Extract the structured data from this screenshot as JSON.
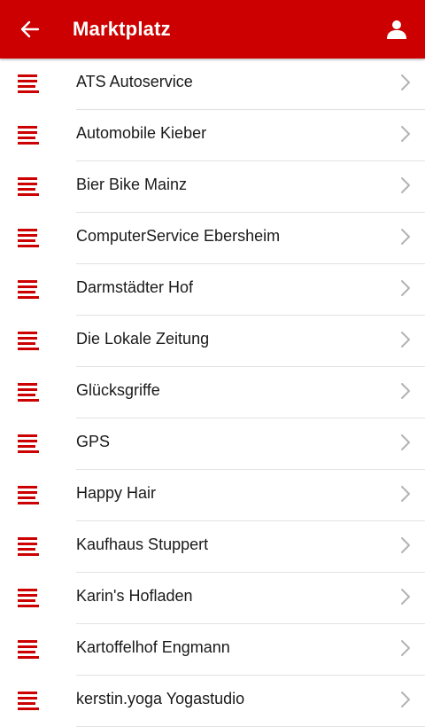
{
  "header": {
    "title": "Marktplatz",
    "back_icon": "arrow-left-icon",
    "account_icon": "user-icon"
  },
  "colors": {
    "primary": "#cc0000",
    "text": "#1a1a1a",
    "chevron": "#b3b3b3",
    "divider": "#e2e2e2"
  },
  "list": {
    "item_icon": "text-lines-icon",
    "items": [
      {
        "label": "ATS Autoservice"
      },
      {
        "label": "Automobile Kieber"
      },
      {
        "label": "Bier Bike Mainz"
      },
      {
        "label": "ComputerService Ebersheim"
      },
      {
        "label": "Darmstädter Hof"
      },
      {
        "label": "Die Lokale Zeitung"
      },
      {
        "label": "Glücksgriffe"
      },
      {
        "label": "GPS"
      },
      {
        "label": "Happy Hair"
      },
      {
        "label": "Kaufhaus Stuppert"
      },
      {
        "label": "Karin's Hofladen"
      },
      {
        "label": "Kartoffelhof Engmann"
      },
      {
        "label": "kerstin.yoga Yogastudio"
      }
    ]
  }
}
